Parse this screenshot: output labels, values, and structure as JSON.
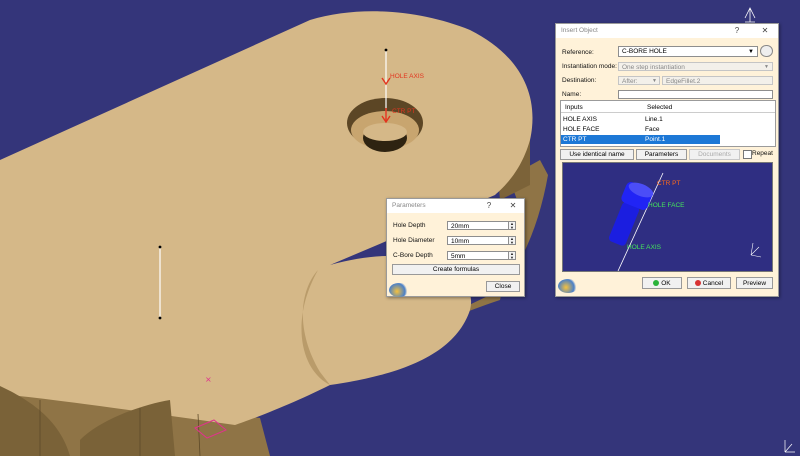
{
  "colors": {
    "background": "#34357a",
    "part_face": "#d5b888",
    "part_side": "#8f7446",
    "dialog_bg": "#fff2d9",
    "selection": "#1d78d6",
    "annotation_red": "#e2341e",
    "annotation_green": "#45e85a",
    "annotation_orange": "#ff6a1a",
    "preview_bg": "#2f2e82",
    "preview_part": "#1b1ee0"
  },
  "viewport": {
    "annotations": {
      "hole_axis": "HOLE AXIS",
      "ctr_pt": "CTR PT"
    }
  },
  "parameters_dialog": {
    "title": "Parameters",
    "help": "?",
    "close_x": "✕",
    "rows": [
      {
        "label": "Hole Depth",
        "value": "20mm"
      },
      {
        "label": "Hole Diameter",
        "value": "10mm"
      },
      {
        "label": "C-Bore Depth",
        "value": "5mm"
      }
    ],
    "create_formulas": "Create formulas",
    "close": "Close"
  },
  "insert_dialog": {
    "title": "Insert Object",
    "help": "?",
    "close_x": "✕",
    "reference_label": "Reference:",
    "reference_value": "C-BORE HOLE",
    "instantiation_label": "Instantiation mode:",
    "instantiation_value": "One step instantiation",
    "destination_label": "Destination:",
    "destination_mode": "After:",
    "destination_value": "EdgeFillet.2",
    "name_label": "Name:",
    "name_value": "",
    "table": {
      "headers": [
        "Inputs",
        "Selected"
      ],
      "rows": [
        {
          "input": "HOLE AXIS",
          "selected": "Line.1"
        },
        {
          "input": "HOLE FACE",
          "selected": "Face"
        },
        {
          "input": "CTR PT",
          "selected": "Point.1"
        }
      ]
    },
    "buttons": {
      "use_identical_name": "Use identical name",
      "parameters": "Parameters",
      "documents": "Documents",
      "repeat": "Repeat"
    },
    "preview_labels": {
      "ctr_pt": "CTR PT",
      "hole_face": "HOLE FACE",
      "hole_axis": "HOLE AXIS"
    },
    "ok": "OK",
    "cancel": "Cancel",
    "preview": "Preview"
  }
}
